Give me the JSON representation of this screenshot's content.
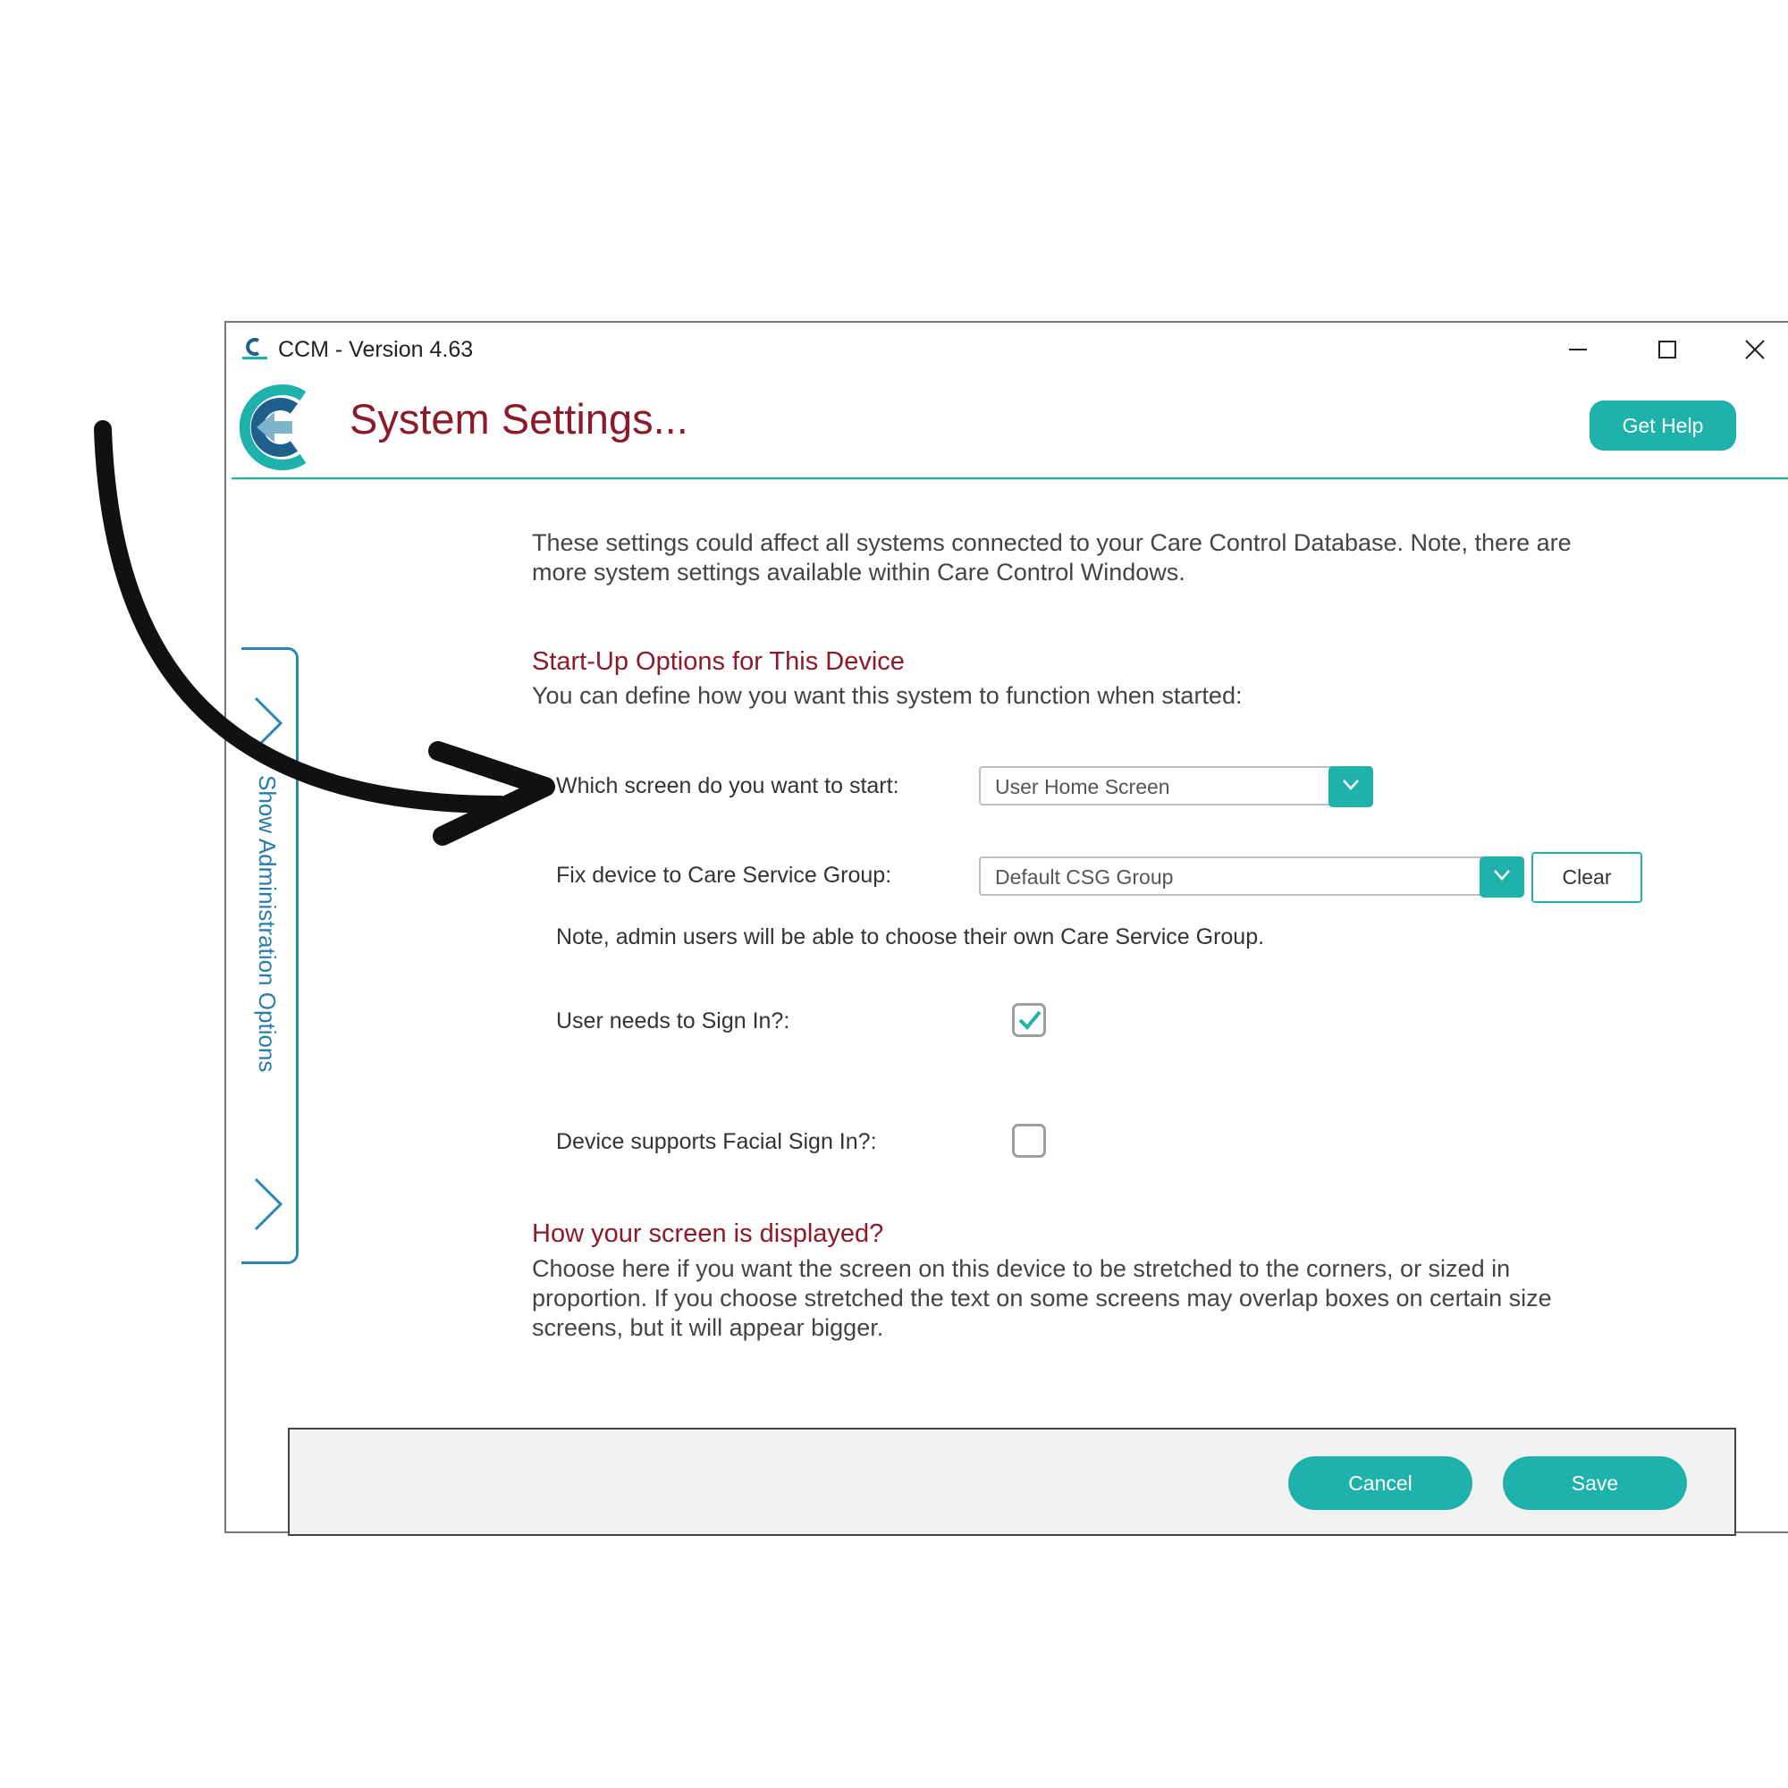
{
  "window": {
    "title": "CCM - Version 4.63"
  },
  "header": {
    "title": "System Settings...",
    "help_label": "Get Help"
  },
  "sidebar": {
    "tab_label": "Show Administration Options"
  },
  "intro": {
    "text": "These settings could affect all systems connected to your Care Control Database.  Note, there are more system settings available within Care Control Windows."
  },
  "startup": {
    "title": "Start-Up Options for This Device",
    "subtitle": "You can define how you want this system to function when started:",
    "start_screen_label": "Which screen do you want to start:",
    "start_screen_value": "User Home Screen",
    "csg_label": "Fix device to Care Service Group:",
    "csg_value": "Default CSG Group",
    "clear_label": "Clear",
    "csg_note": "Note, admin users will be able to choose their own Care Service Group.",
    "sign_in_label": "User needs to Sign In?:",
    "sign_in_checked": true,
    "facial_label": "Device supports Facial Sign In?:",
    "facial_checked": false
  },
  "display": {
    "title": "How your screen is displayed?",
    "text": "Choose here if you want the screen on this device to be stretched to the corners, or sized in proportion.  If you choose stretched the text on some screens may overlap boxes on certain size screens, but it will appear bigger."
  },
  "footer": {
    "cancel_label": "Cancel",
    "save_label": "Save"
  },
  "colors": {
    "accent": "#1fb2ad",
    "title": "#8b1a2b",
    "side_tab": "#2a86b6"
  }
}
